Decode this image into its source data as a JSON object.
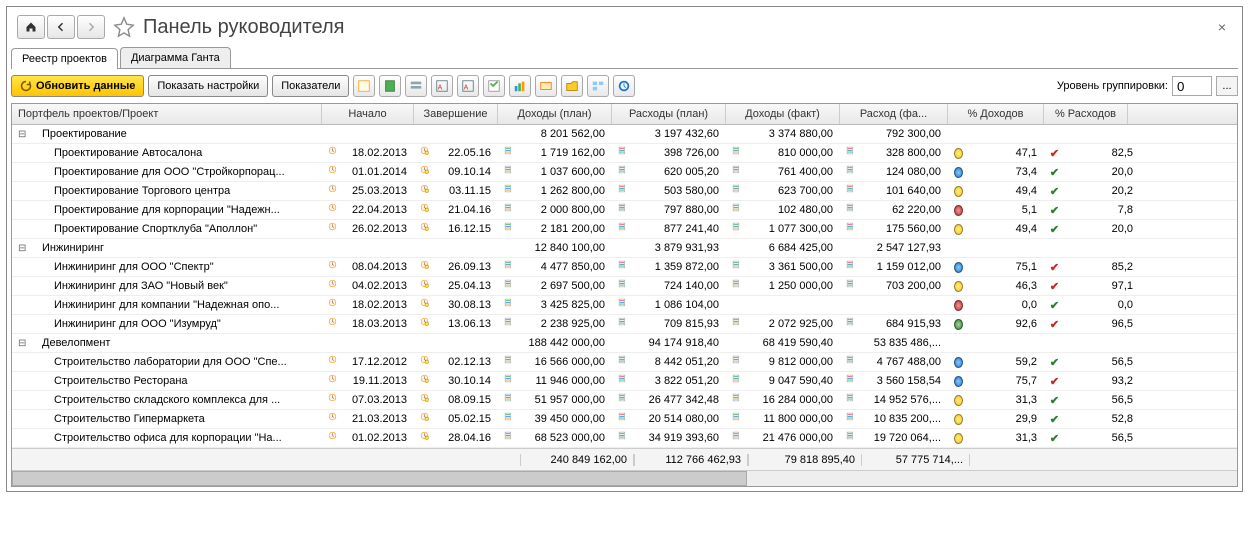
{
  "title": "Панель руководителя",
  "tabs": {
    "registry": "Реестр проектов",
    "gantt": "Диаграмма Ганта"
  },
  "toolbar": {
    "refresh": "Обновить данные",
    "show_settings": "Показать настройки",
    "indicators": "Показатели",
    "group_level_label": "Уровень группировки:",
    "group_level_value": "0",
    "ellipsis": "..."
  },
  "columns": {
    "name": "Портфель проектов/Проект",
    "start": "Начало",
    "finish": "Завершение",
    "income_plan": "Доходы (план)",
    "expense_plan": "Расходы (план)",
    "income_fact": "Доходы (факт)",
    "expense_fact": "Расход (фа...",
    "pct_income": "% Доходов",
    "pct_expense": "% Расходов"
  },
  "groups": [
    {
      "name": "Проектирование",
      "income_plan": "8 201 562,00",
      "expense_plan": "3 197 432,60",
      "income_fact": "3 374 880,00",
      "expense_fact": "792 300,00",
      "rows": [
        {
          "name": "Проектирование Автосалона",
          "start": "18.02.2013",
          "finish": "22.05.16",
          "income_plan": "1 719 162,00",
          "expense_plan": "398 726,00",
          "income_fact": "810 000,00",
          "expense_fact": "328 800,00",
          "led": "y",
          "pct_income": "47,1",
          "chk": "r",
          "pct_expense": "82,5"
        },
        {
          "name": "Проектирование для ООО \"Стройкорпорац...",
          "start": "01.01.2014",
          "finish": "09.10.14",
          "income_plan": "1 037 600,00",
          "expense_plan": "620 005,20",
          "income_fact": "761 400,00",
          "expense_fact": "124 080,00",
          "led": "b",
          "pct_income": "73,4",
          "chk": "g",
          "pct_expense": "20,0"
        },
        {
          "name": "Проектирование Торгового центра",
          "start": "25.03.2013",
          "finish": "03.11.15",
          "income_plan": "1 262 800,00",
          "expense_plan": "503 580,00",
          "income_fact": "623 700,00",
          "expense_fact": "101 640,00",
          "led": "y",
          "pct_income": "49,4",
          "chk": "g",
          "pct_expense": "20,2"
        },
        {
          "name": "Проектирование для корпорации \"Надежн...",
          "start": "22.04.2013",
          "finish": "21.04.16",
          "income_plan": "2 000 800,00",
          "expense_plan": "797 880,00",
          "income_fact": "102 480,00",
          "expense_fact": "62 220,00",
          "led": "r",
          "pct_income": "5,1",
          "chk": "g",
          "pct_expense": "7,8"
        },
        {
          "name": "Проектирование Спортклуба \"Аполлон\"",
          "start": "26.02.2013",
          "finish": "16.12.15",
          "income_plan": "2 181 200,00",
          "expense_plan": "877 241,40",
          "income_fact": "1 077 300,00",
          "expense_fact": "175 560,00",
          "led": "y",
          "pct_income": "49,4",
          "chk": "g",
          "pct_expense": "20,0"
        }
      ]
    },
    {
      "name": "Инжиниринг",
      "income_plan": "12 840 100,00",
      "expense_plan": "3 879 931,93",
      "income_fact": "6 684 425,00",
      "expense_fact": "2 547 127,93",
      "rows": [
        {
          "name": "Инжиниринг для ООО \"Спектр\"",
          "start": "08.04.2013",
          "finish": "26.09.13",
          "income_plan": "4 477 850,00",
          "expense_plan": "1 359 872,00",
          "income_fact": "3 361 500,00",
          "expense_fact": "1 159 012,00",
          "led": "b",
          "pct_income": "75,1",
          "chk": "r",
          "pct_expense": "85,2"
        },
        {
          "name": "Инжиниринг для ЗАО \"Новый век\"",
          "start": "04.02.2013",
          "finish": "25.04.13",
          "income_plan": "2 697 500,00",
          "expense_plan": "724 140,00",
          "income_fact": "1 250 000,00",
          "expense_fact": "703 200,00",
          "led": "y",
          "pct_income": "46,3",
          "chk": "r",
          "pct_expense": "97,1"
        },
        {
          "name": "Инжиниринг для компании \"Надежная опо...",
          "start": "18.02.2013",
          "finish": "30.08.13",
          "income_plan": "3 425 825,00",
          "expense_plan": "1 086 104,00",
          "income_fact": "",
          "expense_fact": "",
          "led": "r",
          "pct_income": "0,0",
          "chk": "g",
          "pct_expense": "0,0"
        },
        {
          "name": "Инжиниринг для ООО \"Изумруд\"",
          "start": "18.03.2013",
          "finish": "13.06.13",
          "income_plan": "2 238 925,00",
          "expense_plan": "709 815,93",
          "income_fact": "2 072 925,00",
          "expense_fact": "684 915,93",
          "led": "g",
          "pct_income": "92,6",
          "chk": "r",
          "pct_expense": "96,5"
        }
      ]
    },
    {
      "name": "Девелопмент",
      "income_plan": "188 442 000,00",
      "expense_plan": "94 174 918,40",
      "income_fact": "68 419 590,40",
      "expense_fact": "53 835 486,...",
      "rows": [
        {
          "name": "Строительство лаборатории для ООО \"Спе...",
          "start": "17.12.2012",
          "finish": "02.12.13",
          "income_plan": "16 566 000,00",
          "expense_plan": "8 442 051,20",
          "income_fact": "9 812 000,00",
          "expense_fact": "4 767 488,00",
          "led": "b",
          "pct_income": "59,2",
          "chk": "g",
          "pct_expense": "56,5"
        },
        {
          "name": "Строительство Ресторана",
          "start": "19.11.2013",
          "finish": "30.10.14",
          "income_plan": "11 946 000,00",
          "expense_plan": "3 822 051,20",
          "income_fact": "9 047 590,40",
          "expense_fact": "3 560 158,54",
          "led": "b",
          "pct_income": "75,7",
          "chk": "r",
          "pct_expense": "93,2"
        },
        {
          "name": "Строительство складского комплекса для ...",
          "start": "07.03.2013",
          "finish": "08.09.15",
          "income_plan": "51 957 000,00",
          "expense_plan": "26 477 342,48",
          "income_fact": "16 284 000,00",
          "expense_fact": "14 952 576,...",
          "led": "y",
          "pct_income": "31,3",
          "chk": "g",
          "pct_expense": "56,5"
        },
        {
          "name": "Строительство Гипермаркета",
          "start": "21.03.2013",
          "finish": "05.02.15",
          "income_plan": "39 450 000,00",
          "expense_plan": "20 514 080,00",
          "income_fact": "11 800 000,00",
          "expense_fact": "10 835 200,...",
          "led": "y",
          "pct_income": "29,9",
          "chk": "g",
          "pct_expense": "52,8"
        },
        {
          "name": "Строительство офиса для корпорации \"На...",
          "start": "01.02.2013",
          "finish": "28.04.16",
          "income_plan": "68 523 000,00",
          "expense_plan": "34 919 393,60",
          "income_fact": "21 476 000,00",
          "expense_fact": "19 720 064,...",
          "led": "y",
          "pct_income": "31,3",
          "chk": "g",
          "pct_expense": "56,5"
        }
      ]
    }
  ],
  "totals": {
    "income_plan": "240 849 162,00",
    "expense_plan": "112 766 462,93",
    "income_fact": "79 818 895,40",
    "expense_fact": "57 775 714,..."
  }
}
